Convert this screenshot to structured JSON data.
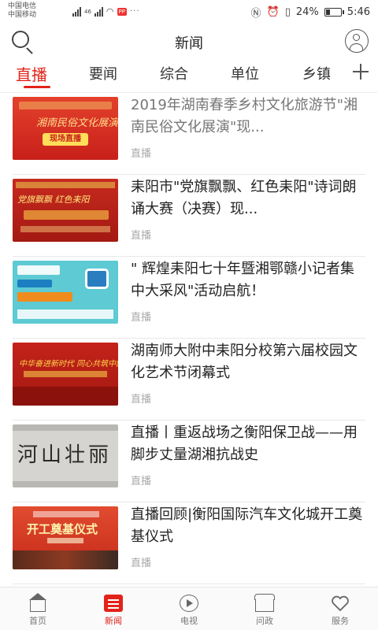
{
  "status_bar": {
    "carrier1": "中国电信",
    "carrier2": "中国移动",
    "net": "46",
    "app_badge": "PP",
    "dots": "···",
    "battery": "24%",
    "time": "5:46"
  },
  "header": {
    "title": "新闻"
  },
  "tabs": [
    {
      "label": "直播",
      "active": true
    },
    {
      "label": "要闻"
    },
    {
      "label": "综合"
    },
    {
      "label": "单位"
    },
    {
      "label": "乡镇"
    }
  ],
  "news": [
    {
      "title": "2019年湖南春季乡村文化旅游节\"湘南民俗文化展演\"现...",
      "tag": "直播",
      "read": true,
      "thumb_text": "湘南民俗文化展演",
      "thumb_badge": "现场直播"
    },
    {
      "title": "耒阳市\"党旗飘飘、红色耒阳\"诗词朗诵大赛（决赛）现...",
      "tag": "直播",
      "thumb_text": "党旗飘飘 红色耒阳"
    },
    {
      "title": "\" 辉煌耒阳七十年暨湘鄂赣小记者集中大采风\"活动启航！",
      "tag": "直播"
    },
    {
      "title": "湖南师大附中耒阳分校第六届校园文化艺术节闭幕式",
      "tag": "直播",
      "thumb_text": "中华奋进新时代 同心共筑中国梦"
    },
    {
      "title": "直播丨重返战场之衡阳保卫战——用脚步丈量湖湘抗战史",
      "tag": "直播",
      "thumb_text": "河山壮丽"
    },
    {
      "title": "直播回顾|衡阳国际汽车文化城开工奠基仪式",
      "tag": "直播",
      "thumb_text": "开工奠基仪式"
    }
  ],
  "bottom_nav": [
    {
      "label": "首页"
    },
    {
      "label": "新闻",
      "active": true
    },
    {
      "label": "电视"
    },
    {
      "label": "问政"
    },
    {
      "label": "服务"
    }
  ],
  "colors": {
    "accent": "#e2231a",
    "read_title": "#777777",
    "tag": "#aaaaaa"
  }
}
